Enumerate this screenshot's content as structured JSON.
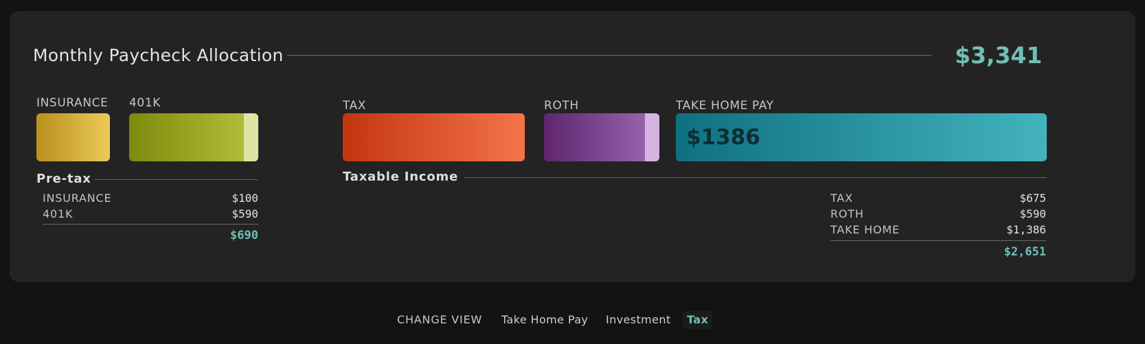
{
  "header": {
    "title": "Monthly Paycheck Allocation",
    "total": "$3,341"
  },
  "segments": {
    "insurance": {
      "label": "INSURANCE"
    },
    "k401": {
      "label": "401K"
    },
    "tax": {
      "label": "TAX"
    },
    "roth": {
      "label": "ROTH"
    },
    "take_home": {
      "label": "TAKE HOME PAY",
      "value": "$1386"
    }
  },
  "pretax": {
    "heading": "Pre-tax",
    "rows": [
      {
        "label": "INSURANCE",
        "amount": "$100"
      },
      {
        "label": "401K",
        "amount": "$590"
      }
    ],
    "total": "$690"
  },
  "taxable": {
    "heading": "Taxable Income",
    "rows": [
      {
        "label": "TAX",
        "amount": "$675"
      },
      {
        "label": "ROTH",
        "amount": "$590"
      },
      {
        "label": "TAKE HOME",
        "amount": "$1,386"
      }
    ],
    "total": "$2,651"
  },
  "footer": {
    "label": "CHANGE VIEW",
    "options": [
      "Take Home Pay",
      "Investment",
      "Tax"
    ],
    "active": "Tax"
  },
  "colors": {
    "accent": "#6fc0b6",
    "insurance": "#d4af3a",
    "k401": "#9aa626",
    "tax": "#e0552e",
    "roth": "#7f4794",
    "take_home": "#2996a3"
  }
}
